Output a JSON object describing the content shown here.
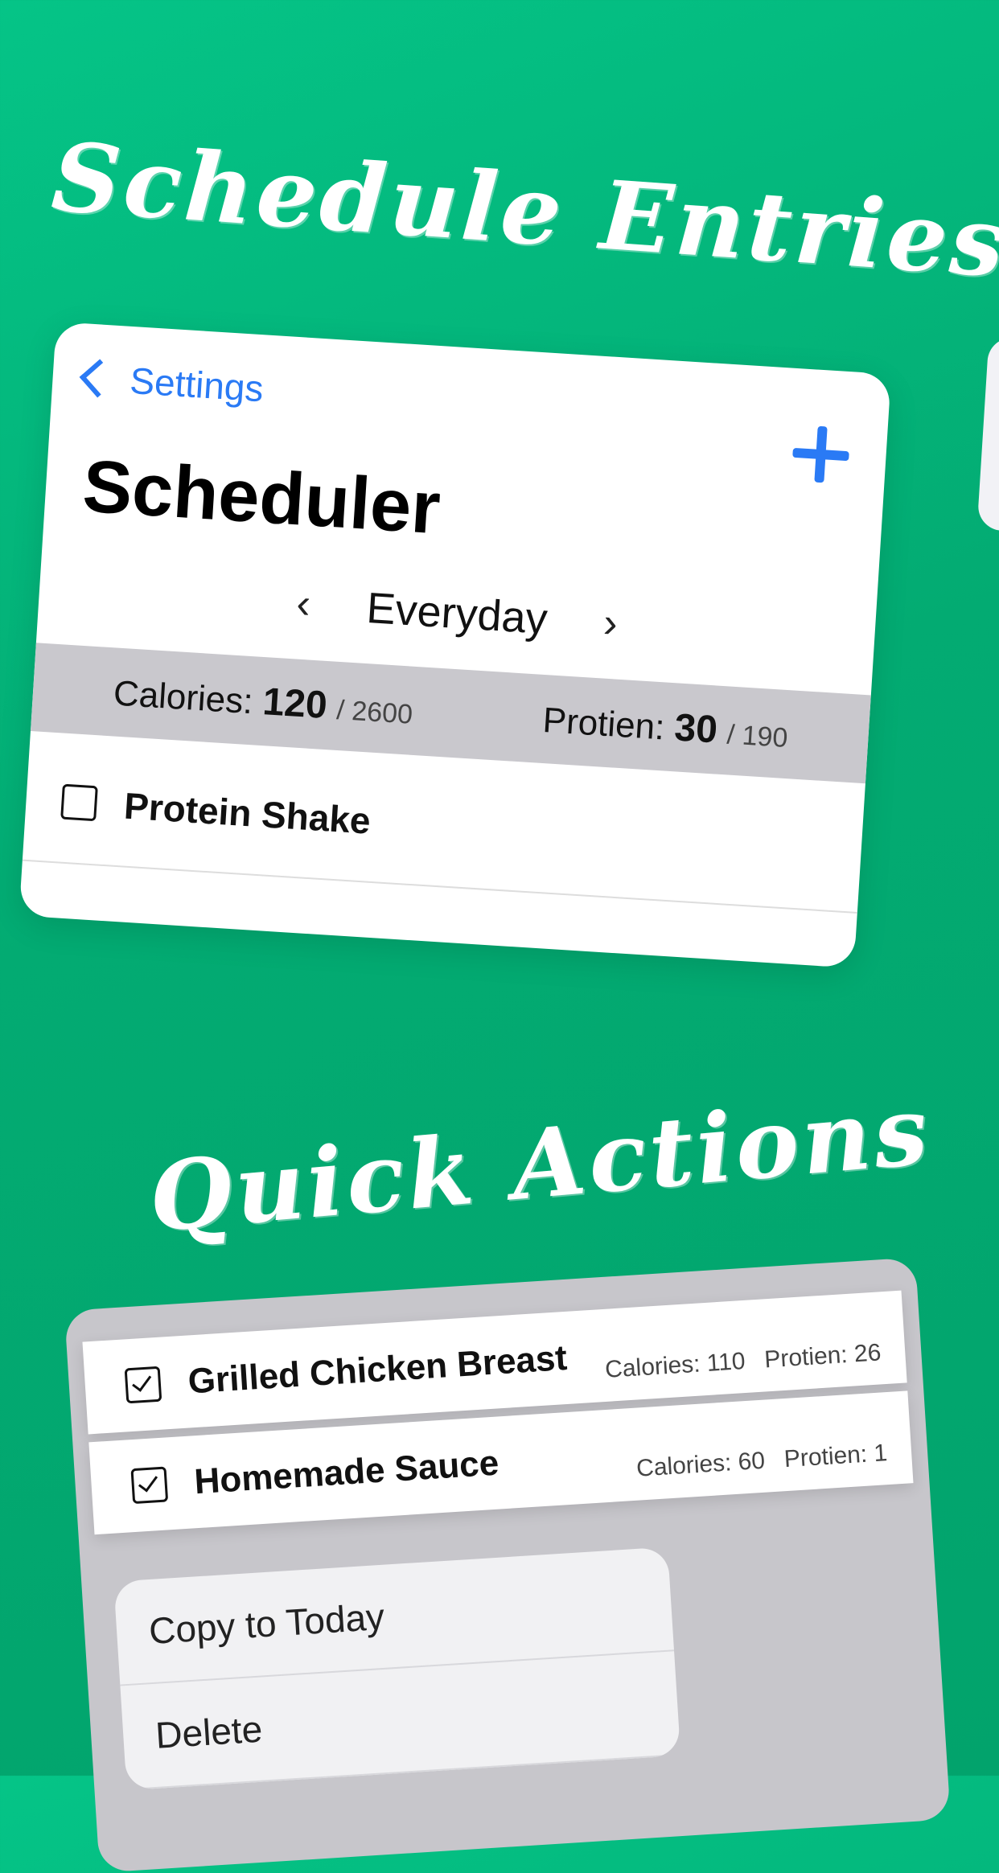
{
  "headlines": {
    "top": "Schedule Entries",
    "bottom": "Quick Actions"
  },
  "scheduler": {
    "back_label": "Settings",
    "title": "Scheduler",
    "day": "Everyday",
    "calories_label": "Calories:",
    "calories_value": "120",
    "calories_max": "/ 2600",
    "protein_label": "Protien:",
    "protein_value": "30",
    "protein_max": "/ 190",
    "items": [
      {
        "name": "Protein Shake",
        "checked": false
      }
    ]
  },
  "quick_actions": {
    "entries": [
      {
        "name": "Grilled Chicken Breast",
        "calories": "Calories: 110",
        "protein": "Protien: 26",
        "checked": true
      },
      {
        "name": "Homemade Sauce",
        "calories": "Calories: 60",
        "protein": "Protien: 1",
        "checked": true
      }
    ],
    "menu": [
      "Copy to Today",
      "Delete"
    ]
  },
  "colors": {
    "accent": "#2a7af5",
    "background": "#03ab72",
    "stats_bar": "#c9c8cd"
  }
}
